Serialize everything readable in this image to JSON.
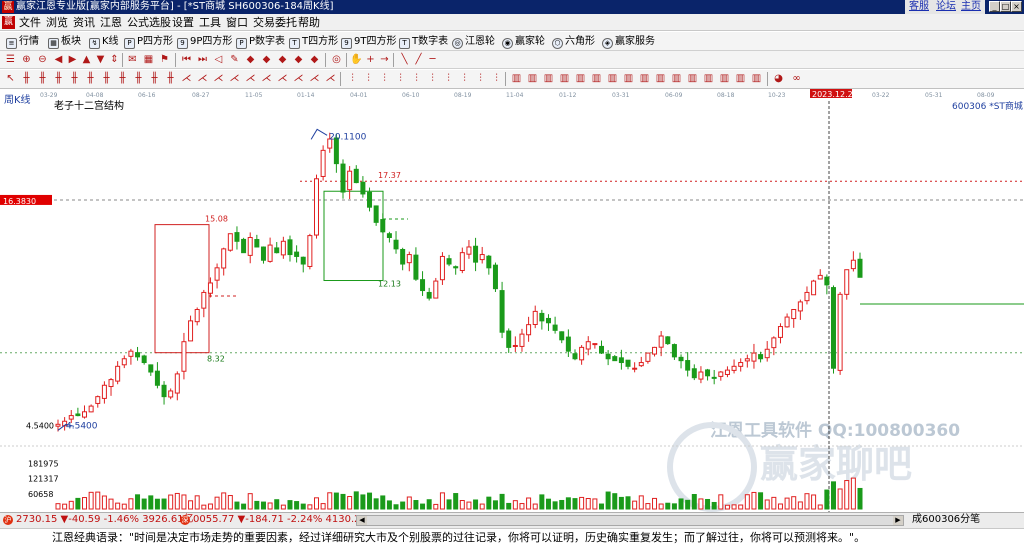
{
  "titlebar": {
    "icon": "赢",
    "text": "赢家江恩专业版[赢家内部服务平台] - [*ST商城  SH600306-184周K线]",
    "links": [
      "客服",
      "论坛",
      "主页"
    ],
    "window_buttons": [
      "_",
      "□",
      "×"
    ]
  },
  "menubar": {
    "items": [
      "文件",
      "浏览",
      "资讯",
      "江恩",
      "公式选股",
      "设置",
      "工具",
      "窗口",
      "交易委托",
      "帮助"
    ]
  },
  "toolbar1": {
    "items": [
      "行情",
      "板块",
      "K线",
      "P四方形",
      "9P四方形",
      "P数字表",
      "T四方形",
      "9T四方形",
      "T数字表",
      "江恩轮",
      "赢家轮",
      "六角形",
      "赢家服务"
    ]
  },
  "chart": {
    "panel_label": "周K线",
    "structure_label": "老子十二宫结构",
    "symbol_label": "600306  *ST商城",
    "date_ticks": [
      "03-29",
      "04-08",
      "06-16",
      "08-27",
      "11-05",
      "01-14",
      "04-01",
      "06-10",
      "08-19",
      "11-04",
      "01-12",
      "03-31",
      "06-09",
      "08-18",
      "10-23",
      "03-22",
      "05-31",
      "08-09"
    ],
    "cursor_date": "2023.12.22",
    "price_marker": "16.3830",
    "y_axis_ticks": [
      {
        "label": "4.5400",
        "value": 4.54
      }
    ],
    "volume_ticks": [
      {
        "label": "181975",
        "value": 181975
      },
      {
        "label": "121317",
        "value": 121317
      },
      {
        "label": "60658",
        "value": 60658
      }
    ],
    "annotations": {
      "high": "20.1100",
      "low": "4.5400",
      "red_box_top": "15.08",
      "red_box_bottom": "8.32",
      "green_box_top": "17.37",
      "green_box_bottom": "12.13"
    },
    "watermark_line1": "江恩工具软件  QQ:100800360",
    "watermark_line2": "赢家聊吧",
    "colors": {
      "up": "#e02020",
      "down": "#1a9a1a",
      "price_marker_bg": "#e00000",
      "axis_text": "#2040a0"
    }
  },
  "chart_data": {
    "type": "candlestick",
    "title": "",
    "xlabel": "",
    "ylabel": "",
    "ylim": [
      3.5,
      21.5
    ],
    "high": 20.11,
    "low": 4.54,
    "red_box": {
      "top": 15.08,
      "bottom": 8.32
    },
    "green_box": {
      "top": 17.37,
      "bottom": 12.13
    },
    "reference_line": 16.383,
    "close_path": [
      4.54,
      4.7,
      5.0,
      5.0,
      5.2,
      5.5,
      6.0,
      6.6,
      6.9,
      7.6,
      8.0,
      8.4,
      8.1,
      7.8,
      7.3,
      6.6,
      6.0,
      6.3,
      7.2,
      8.9,
      10.0,
      10.6,
      11.5,
      12.0,
      12.8,
      13.8,
      14.6,
      14.2,
      13.6,
      14.4,
      13.9,
      13.2,
      14.0,
      13.6,
      14.2,
      13.5,
      13.4,
      13.0,
      14.5,
      17.5,
      19.0,
      19.6,
      18.3,
      16.8,
      17.9,
      17.3,
      16.7,
      16.0,
      15.2,
      14.7,
      14.4,
      13.8,
      13.0,
      13.5,
      12.2,
      11.6,
      11.2,
      12.1,
      13.4,
      13.0,
      12.8,
      13.6,
      13.9,
      13.1,
      13.5,
      12.8,
      11.7,
      9.4,
      8.6,
      8.7,
      9.3,
      9.8,
      10.5,
      10.0,
      9.9,
      9.5,
      9.0,
      8.4,
      8.0,
      8.6,
      8.9,
      8.8,
      8.3,
      8.0,
      7.9,
      7.8,
      7.6,
      7.5,
      7.8,
      8.3,
      8.6,
      9.2,
      8.8,
      8.1,
      7.9,
      7.4,
      7.0,
      7.3,
      7.1,
      7.0,
      7.3,
      7.4,
      7.6,
      7.8,
      8.0,
      8.3,
      8.0,
      8.5,
      9.1,
      9.7,
      10.2,
      10.6,
      11.0,
      11.5,
      12.1,
      12.4,
      11.9,
      7.5,
      11.4,
      12.7,
      13.2,
      12.3
    ]
  },
  "statusbar": {
    "index1_badge": "沪",
    "index1": "2730.15 ▼-40.59 -1.46% 3926.61亿",
    "index2_badge": "深",
    "index2": "0055.77 ▼-184.71 -2.24% 4130.2",
    "right_label": "成600306分笔"
  },
  "quote": {
    "text": "江恩经典语录：\"时间是决定市场走势的重要因素，经过详细研究大市及个别股票的过往记录，你将可以证明，历史确实重复发生；而了解过往，你将可以预测将来。\"。"
  }
}
